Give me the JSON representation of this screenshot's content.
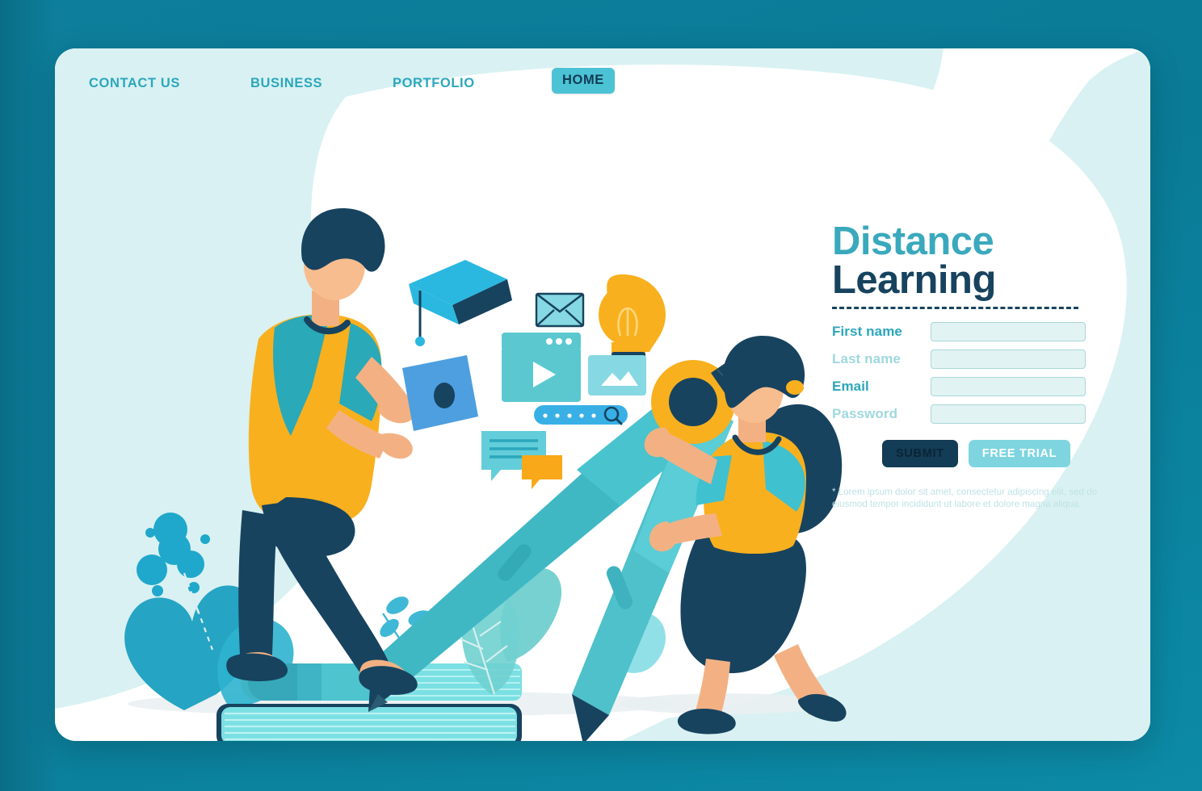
{
  "nav": {
    "items": [
      {
        "label": "CONTACT US",
        "active": false
      },
      {
        "label": "BUSINESS",
        "active": false
      },
      {
        "label": "PORTFOLIO",
        "active": false
      }
    ],
    "home_label": "HOME"
  },
  "hero": {
    "title_line1": "Distance",
    "title_line2": "Learning"
  },
  "form": {
    "fields": [
      {
        "label": "First name",
        "value": "",
        "placeholder": ""
      },
      {
        "label": "Last name",
        "value": "",
        "placeholder": ""
      },
      {
        "label": "Email",
        "value": "",
        "placeholder": ""
      },
      {
        "label": "Password",
        "value": "",
        "placeholder": ""
      }
    ],
    "submit_label": "SUBMIT",
    "trial_label": "FREE TRIAL",
    "note": "* Lorem ipsum dolor sit amet, consectetur adipiscing elit, sed do eiusmod tempor incididunt ut labore et dolore magna aliqua."
  },
  "illustration": {
    "icons": [
      "graduation-cap-icon",
      "envelope-icon",
      "lightbulb-icon",
      "video-player-icon",
      "image-placeholder-icon",
      "search-bar-icon",
      "chat-bubble-icon"
    ],
    "figures": [
      "man-with-tablet",
      "woman-with-compass"
    ],
    "objects": [
      "stacked-books",
      "drafting-compass",
      "plant-left",
      "plant-right"
    ]
  },
  "colors": {
    "page_bg": "#0d7f9c",
    "card_bg": "#ffffff",
    "mint": "#d9f1f2",
    "accent_teal": "#2ba7bc",
    "accent_teal_light": "#4cc3d4",
    "navy": "#17435f",
    "yellow": "#f9b01e",
    "input_bg": "#e2f3f3",
    "input_border": "#a8d7d8"
  }
}
